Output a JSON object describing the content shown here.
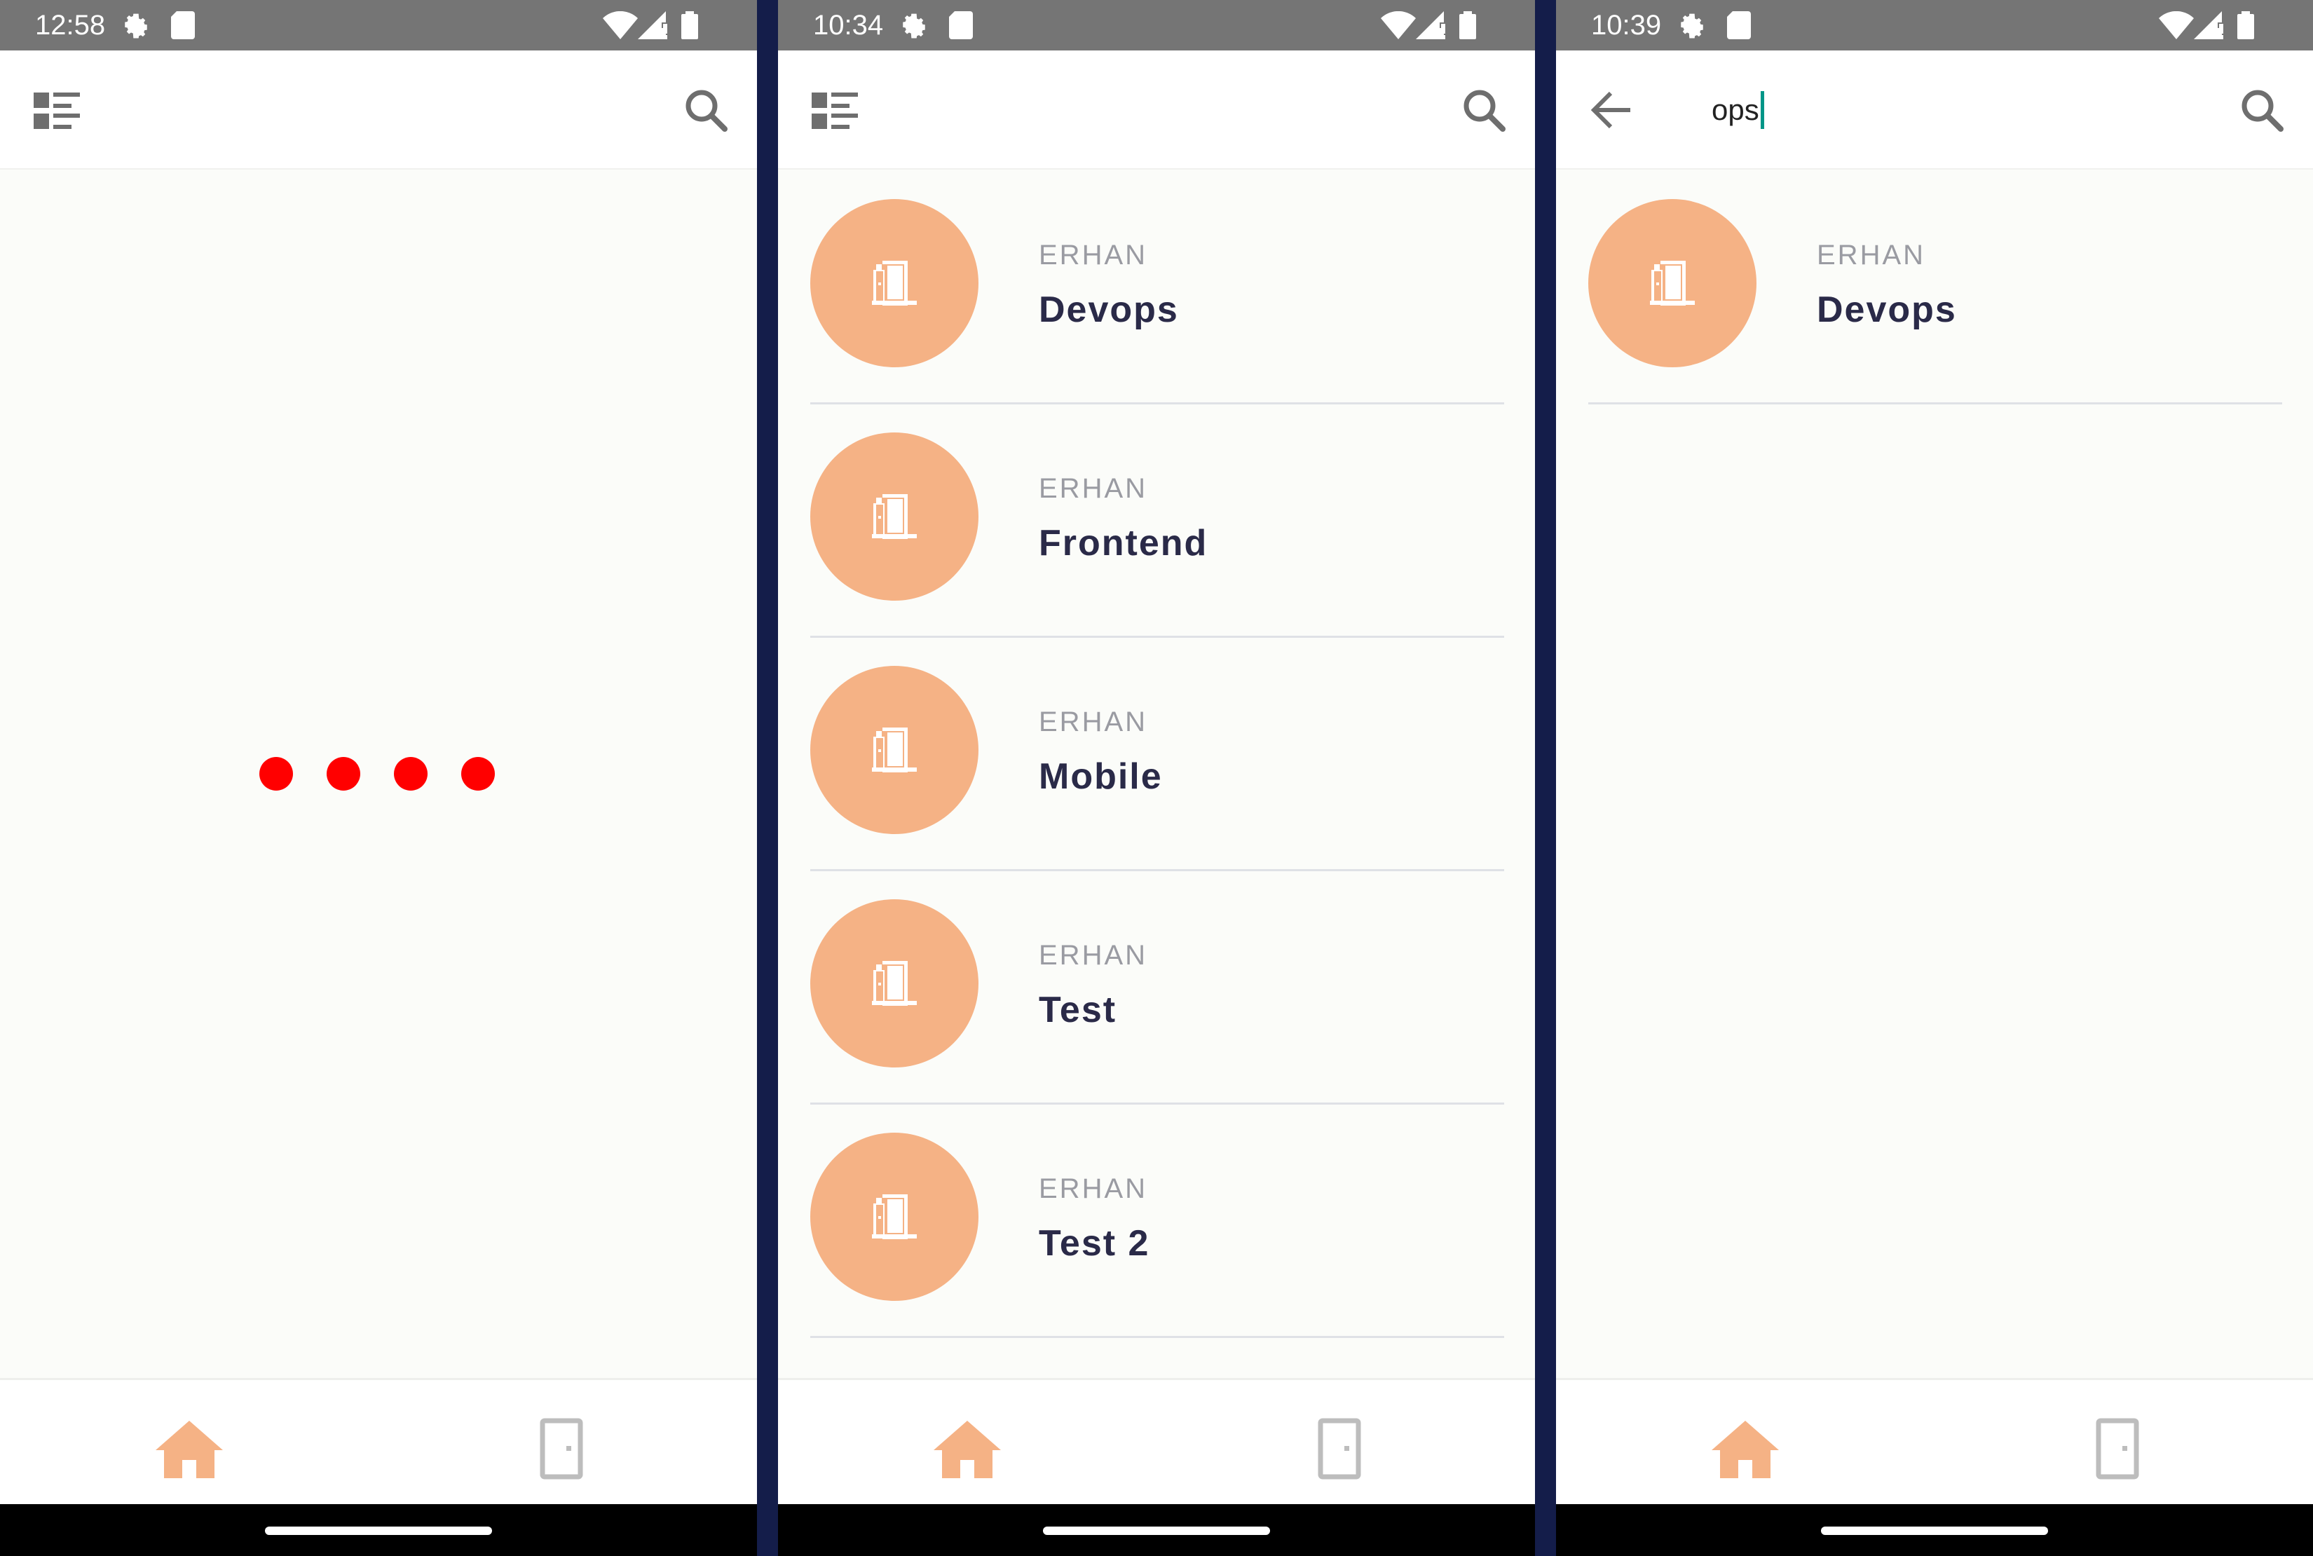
{
  "colors": {
    "accent": "#f5b285",
    "loader_dot": "#ff0000",
    "status_bar": "#757575",
    "divider_between_screens": "#141d4a",
    "text_title": "#2a2a48",
    "text_owner": "#9a9ba2",
    "cursor": "#009688"
  },
  "screens": [
    {
      "status_bar": {
        "time": "12:58"
      },
      "app_bar": {
        "left_icon": "menu-list-icon",
        "right_icon": "search-icon"
      },
      "content": {
        "state": "loading",
        "loader_dot_count": 4
      },
      "bottom_nav": {
        "items": [
          "home-icon",
          "door-icon"
        ],
        "active": "home-icon"
      }
    },
    {
      "status_bar": {
        "time": "10:34"
      },
      "app_bar": {
        "left_icon": "menu-list-icon",
        "right_icon": "search-icon"
      },
      "rooms": [
        {
          "owner": "ERHAN",
          "name": "Devops"
        },
        {
          "owner": "ERHAN",
          "name": "Frontend"
        },
        {
          "owner": "ERHAN",
          "name": "Mobile"
        },
        {
          "owner": "ERHAN",
          "name": "Test"
        },
        {
          "owner": "ERHAN",
          "name": "Test 2"
        }
      ],
      "bottom_nav": {
        "items": [
          "home-icon",
          "door-icon"
        ],
        "active": "home-icon"
      }
    },
    {
      "status_bar": {
        "time": "10:39"
      },
      "app_bar": {
        "left_icon": "back-arrow-icon",
        "search_value": "ops",
        "right_icon": "search-icon"
      },
      "rooms": [
        {
          "owner": "ERHAN",
          "name": "Devops"
        }
      ],
      "bottom_nav": {
        "items": [
          "home-icon",
          "door-icon"
        ],
        "active": "home-icon"
      }
    }
  ]
}
